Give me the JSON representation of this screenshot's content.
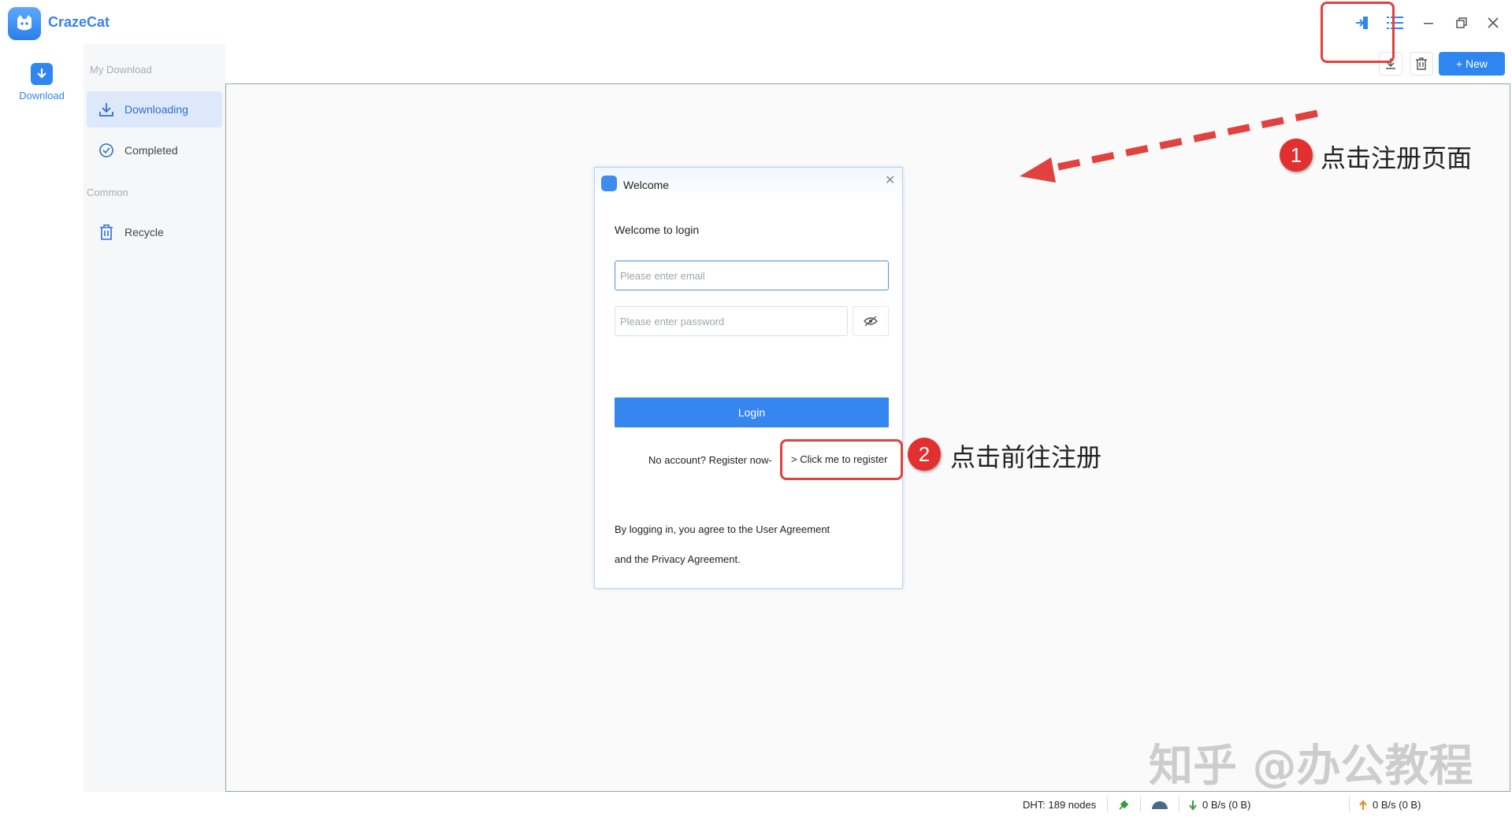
{
  "app": {
    "name": "CrazeCat"
  },
  "rail": {
    "download_label": "Download"
  },
  "sidebar": {
    "section_my_download": "My Download",
    "items": [
      {
        "label": "Downloading",
        "icon": "download-tray-icon"
      },
      {
        "label": "Completed",
        "icon": "check-circle-icon"
      }
    ],
    "section_common": "Common",
    "recycle_label": "Recycle"
  },
  "toolbar": {
    "new_label": "+ New"
  },
  "dialog": {
    "title": "Welcome",
    "heading": "Welcome to login",
    "email_placeholder": "Please enter email",
    "password_placeholder": "Please enter password",
    "login_label": "Login",
    "no_account_text": "No account? Register now-",
    "register_link": "> Click me to register",
    "agreement_line1": "By logging in, you agree to the User Agreement",
    "agreement_line2": "and the Privacy Agreement."
  },
  "annotations": {
    "step1_number": "1",
    "step1_text": "点击注册页面",
    "step2_number": "2",
    "step2_text": "点击前往注册",
    "watermark": "知乎 @办公教程"
  },
  "statusbar": {
    "dht": "DHT: 189 nodes",
    "download_speed": "0 B/s (0 B)",
    "upload_speed": "0 B/s (0 B)"
  },
  "colors": {
    "accent": "#2f86f0",
    "annotation_red": "#e1413f"
  }
}
